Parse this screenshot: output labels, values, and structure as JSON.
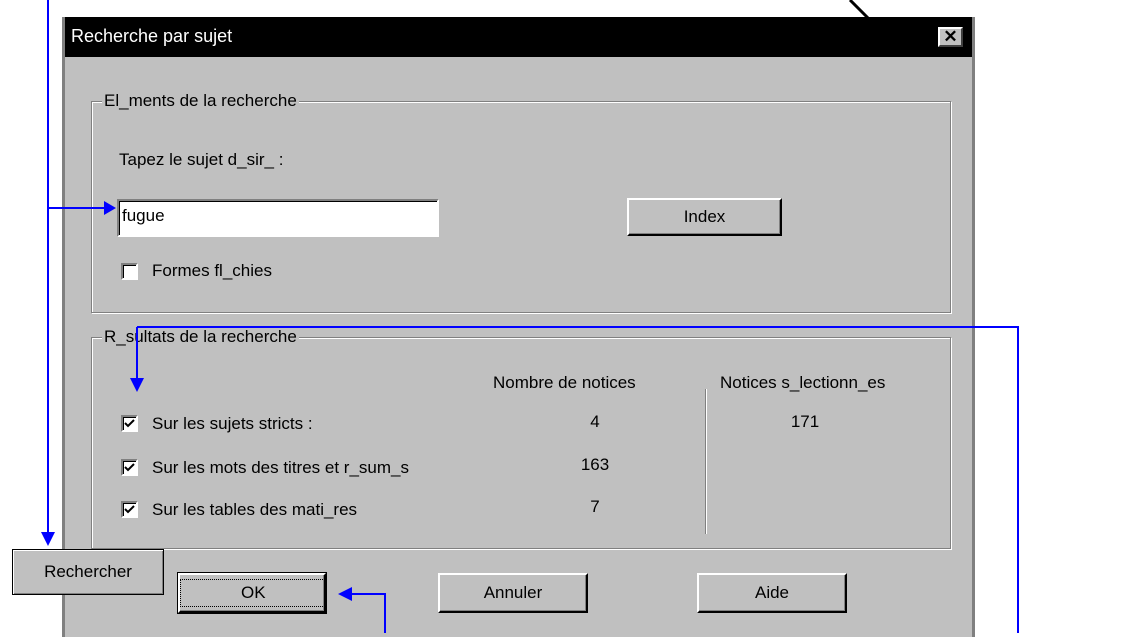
{
  "dialog": {
    "title": "Recherche par sujet",
    "close_glyph": "✕"
  },
  "search_group": {
    "legend": "El_ments de la recherche",
    "prompt": "Tapez le sujet d_sir_ :",
    "subject_value": "fugue",
    "index_button": "Index",
    "formes_label": "Formes fl_chies",
    "formes_checked": false
  },
  "results_group": {
    "legend": "R_sultats de la recherche",
    "col_notices": "Nombre de notices",
    "col_selected": "Notices s_lectionn_es",
    "rows": [
      {
        "label": "Sur les sujets stricts :",
        "checked": true,
        "count": "4"
      },
      {
        "label": "Sur les mots des titres et r_sum_s",
        "checked": true,
        "count": "163"
      },
      {
        "label": "Sur les tables des mati_res",
        "checked": true,
        "count": "7"
      }
    ],
    "selected_count": "171"
  },
  "buttons": {
    "ok": "OK",
    "cancel": "Annuler",
    "help": "Aide"
  },
  "callout": {
    "label": "Rechercher"
  },
  "colors": {
    "arrow": "#0000ff",
    "dialog_bg": "#c0c0c0",
    "titlebar": "#000000"
  }
}
